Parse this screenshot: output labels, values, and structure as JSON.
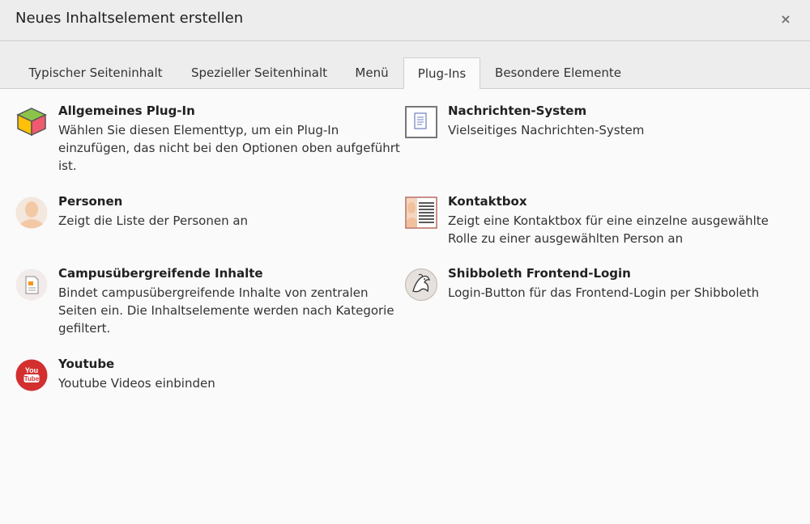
{
  "dialog": {
    "title": "Neues Inhaltselement erstellen",
    "close_symbol": "×"
  },
  "tabs": [
    {
      "label": "Typischer Seiteninhalt",
      "active": false
    },
    {
      "label": "Spezieller Seitenhinalt",
      "active": false
    },
    {
      "label": "Menü",
      "active": false
    },
    {
      "label": "Plug-Ins",
      "active": true
    },
    {
      "label": "Besondere Elemente",
      "active": false
    }
  ],
  "items": [
    {
      "title": "Allgemeines Plug-In",
      "description": "Wählen Sie diesen Elementtyp, um ein Plug-In einzufügen, das nicht bei den Optionen oben aufgeführt ist.",
      "icon": "cube-icon"
    },
    {
      "title": "Nachrichten-System",
      "description": "Vielseitiges Nachrichten-System",
      "icon": "news-icon"
    },
    {
      "title": "Personen",
      "description": "Zeigt die Liste der Personen an",
      "icon": "person-icon"
    },
    {
      "title": "Kontaktbox",
      "description": "Zeigt eine Kontaktbox für eine einzelne ausgewählte Rolle zu einer ausgewählten Person an",
      "icon": "contact-box-icon"
    },
    {
      "title": "Campusübergreifende Inhalte",
      "description": "Bindet campusübergreifende Inhalte von zentralen Seiten ein. Die Inhaltselemente werden nach Kategorie gefiltert.",
      "icon": "document-icon"
    },
    {
      "title": "Shibboleth Frontend-Login",
      "description": "Login-Button für das Frontend-Login per Shibboleth",
      "icon": "shibboleth-icon"
    },
    {
      "title": "Youtube",
      "description": "Youtube Videos einbinden",
      "icon": "youtube-icon"
    }
  ],
  "youtube_icon_text": {
    "line1": "You",
    "line2": "Tube"
  }
}
